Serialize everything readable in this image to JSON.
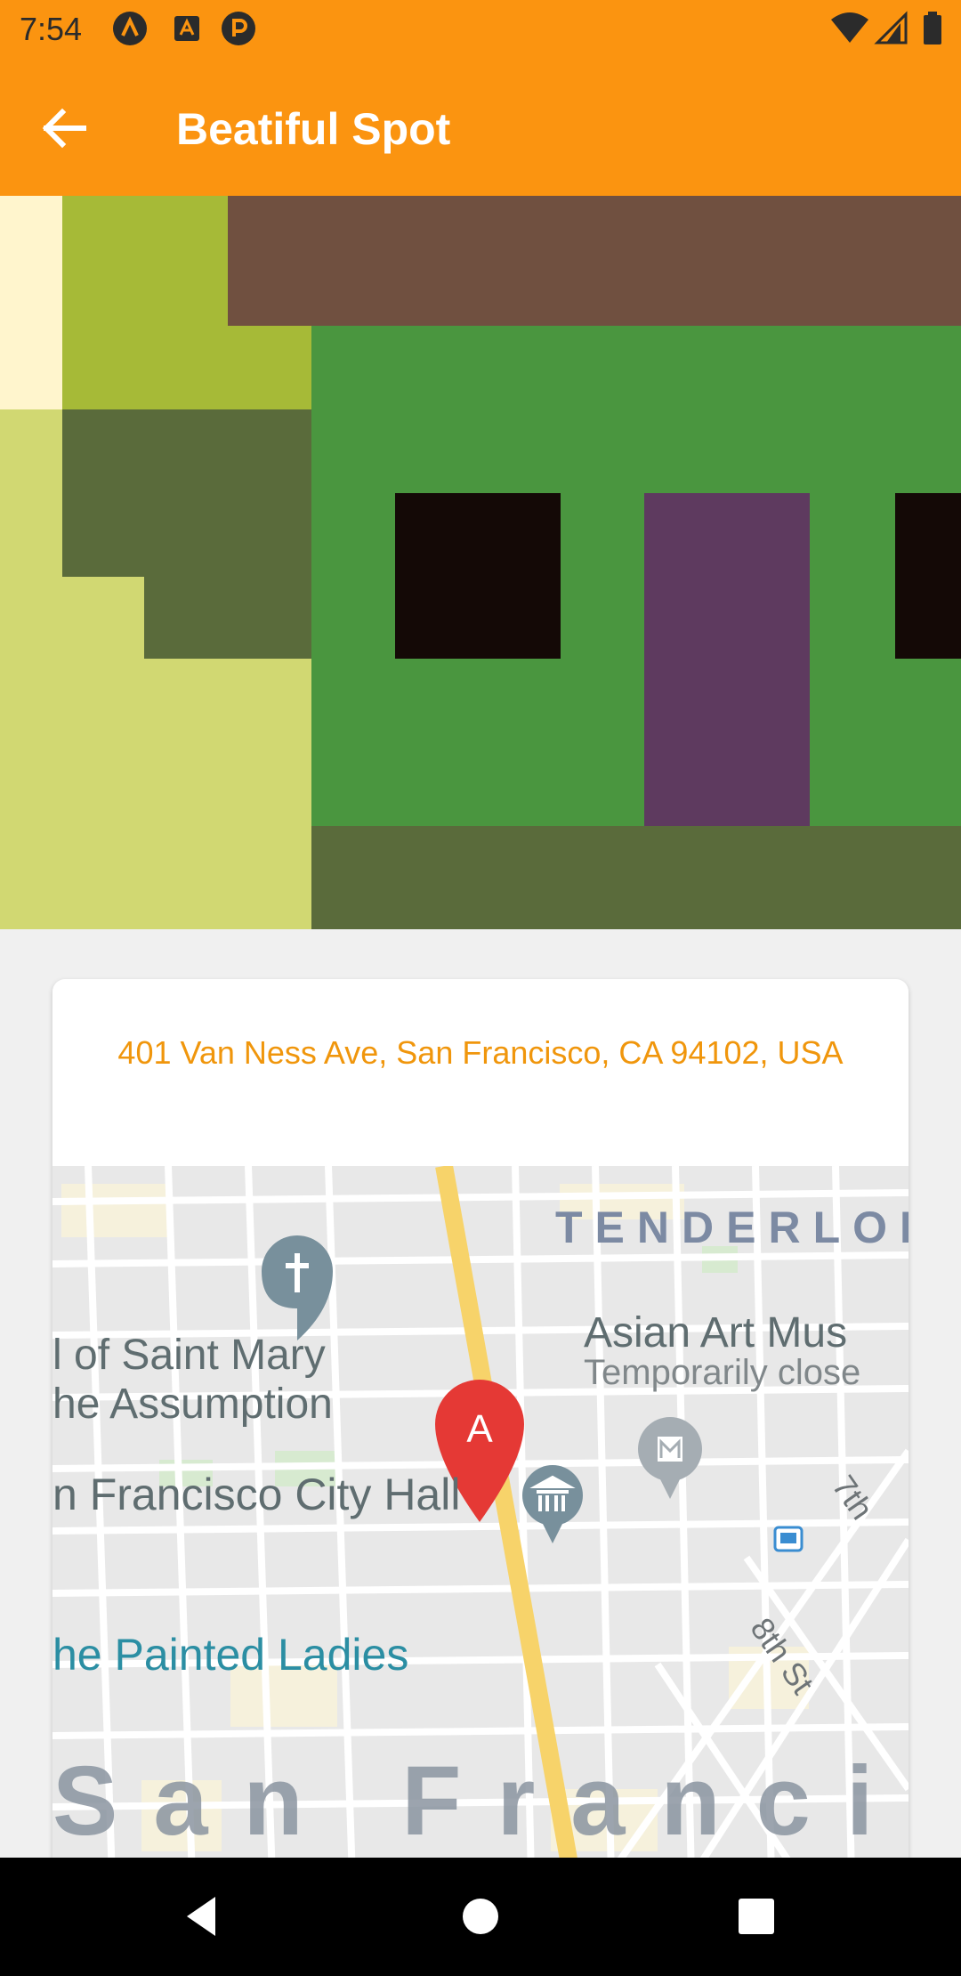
{
  "status_bar": {
    "time": "7:54",
    "notification_icons": [
      "a-circle-icon",
      "a-box-icon",
      "parking-p-icon"
    ],
    "system_icons": [
      "wifi-icon",
      "signal-icon",
      "battery-icon"
    ]
  },
  "app_bar": {
    "title": "Beatiful Spot",
    "back_icon": "arrow-left-icon"
  },
  "hero_image": {
    "description_icon": "pixel-art-image",
    "colors": [
      "#fff5cd",
      "#a6ba37",
      "#705040",
      "#4a963f",
      "#5a6b3b",
      "#d1d872",
      "#140906",
      "#5e3a5f"
    ]
  },
  "location_card": {
    "address": "401 Van Ness Ave, San Francisco, CA 94102, USA",
    "map": {
      "labels": {
        "tenderloin": "TENDERLOI",
        "asian_art_museum": "Asian Art Mus",
        "temporarily_closed": "Temporarily close",
        "cathedral_line1": "l of Saint Mary",
        "cathedral_line2": "he Assumption",
        "city_hall": "n Francisco City Hall",
        "painted_ladies": "he Painted Ladies",
        "san_francisco": "San Francis",
        "seventh_st": "7th",
        "eighth_st": "8th St"
      },
      "marker_label": "A",
      "marker_color": "#e53935"
    }
  },
  "nav_bar": {
    "buttons": [
      "back-triangle-icon",
      "home-circle-icon",
      "recents-square-icon"
    ]
  }
}
